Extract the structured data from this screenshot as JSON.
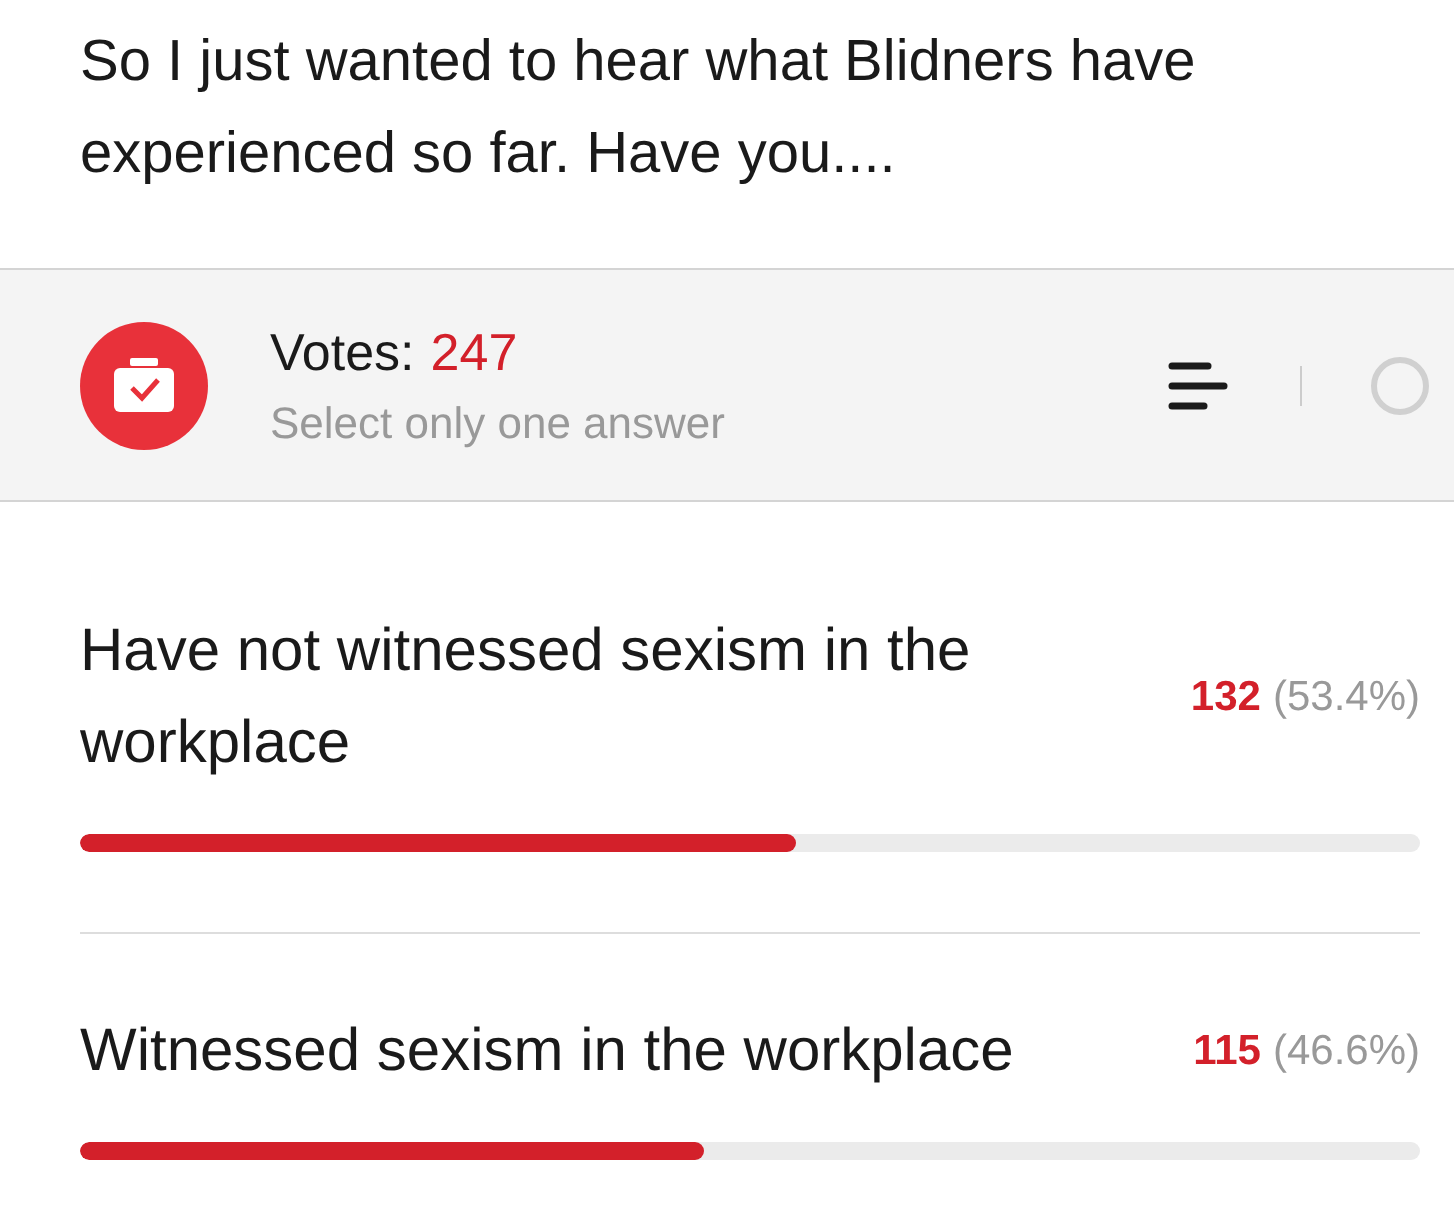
{
  "post_text": "So I just wanted to hear what Blidners have experienced so far. Have you....",
  "poll": {
    "votes_label": "Votes:",
    "votes_count": "247",
    "instruction": "Select only one answer",
    "options": [
      {
        "label": "Have not witnessed sexism in the workplace",
        "count": "132",
        "percent": "(53.4%)",
        "level": 0.534
      },
      {
        "label": "Witnessed sexism in the workplace",
        "count": "115",
        "percent": "(46.6%)",
        "level": 0.466
      }
    ]
  }
}
